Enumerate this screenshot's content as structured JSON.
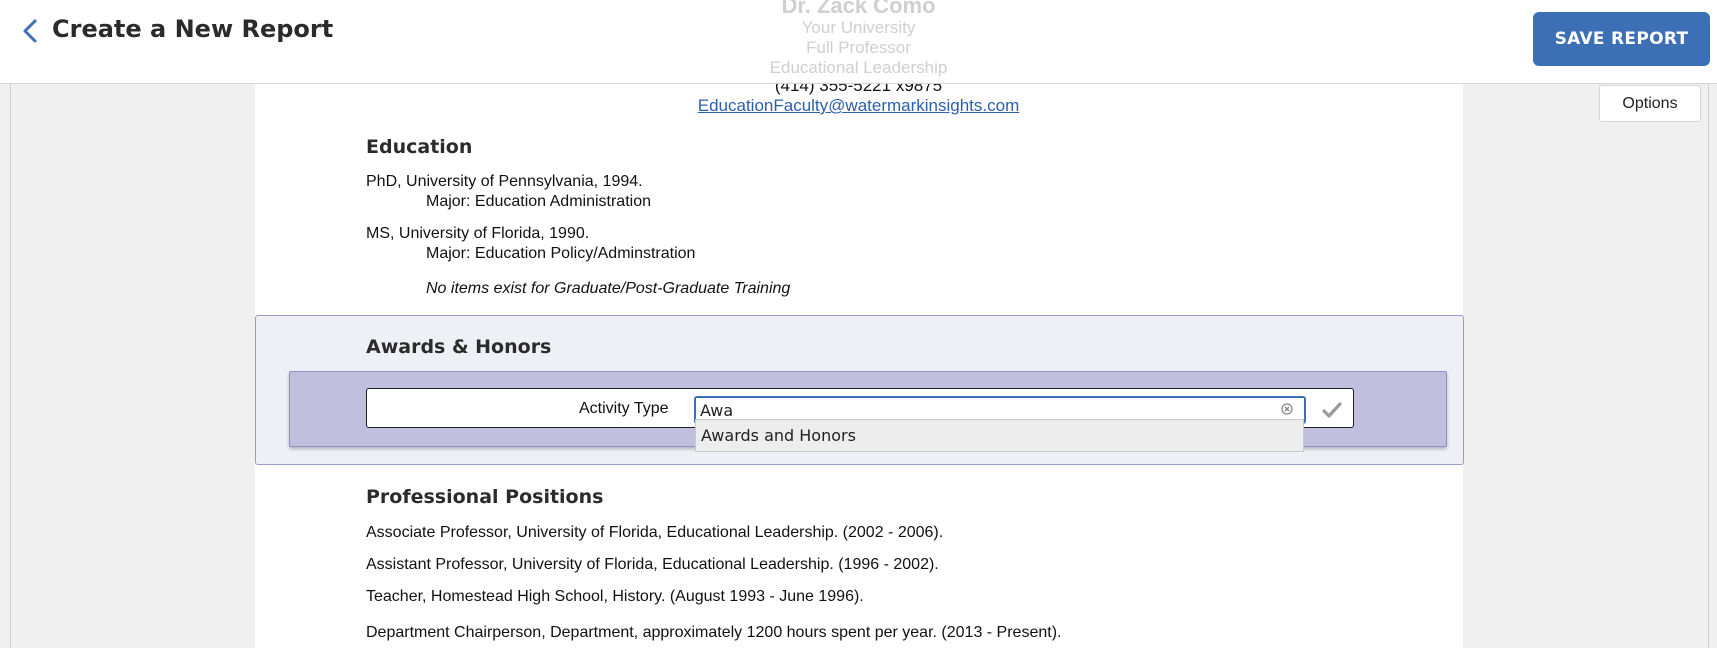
{
  "header": {
    "title": "Create a New Report",
    "save_label": "SAVE REPORT"
  },
  "cv_header": {
    "name": "Dr. Zack Como",
    "university": "Your University",
    "rank": "Full Professor",
    "department": "Educational Leadership",
    "phone": "(414) 355-5221 x9875",
    "email": "EducationFaculty@watermarkinsights.com"
  },
  "options_label": "Options",
  "education": {
    "title": "Education",
    "entries": [
      {
        "degree": "PhD, University of Pennsylvania, 1994.",
        "major": "Major: Education Administration"
      },
      {
        "degree": "MS, University of Florida, 1990.",
        "major": "Major: Education Policy/Adminstration"
      }
    ],
    "empty_note": "No items exist for Graduate/Post-Graduate Training"
  },
  "awards": {
    "title": "Awards & Honors",
    "activity_label": "Activity Type",
    "activity_value": "Awa",
    "suggestions": [
      "Awards and Honors"
    ]
  },
  "positions": {
    "title": "Professional Positions",
    "entries": [
      "Associate Professor, University of Florida, Educational Leadership. (2002 - 2006).",
      "Assistant Professor, University of Florida, Educational Leadership. (1996 - 2002).",
      "Teacher, Homestead High School, History. (August 1993 - June 1996).",
      "Department Chairperson, Department, approximately 1200 hours spent per year. (2013 - Present)."
    ]
  },
  "colors": {
    "accent": "#3c6fb5",
    "awards_panel": "#eef0f6",
    "activity_bar": "#c0bfdd",
    "link": "#2d5fb0"
  }
}
